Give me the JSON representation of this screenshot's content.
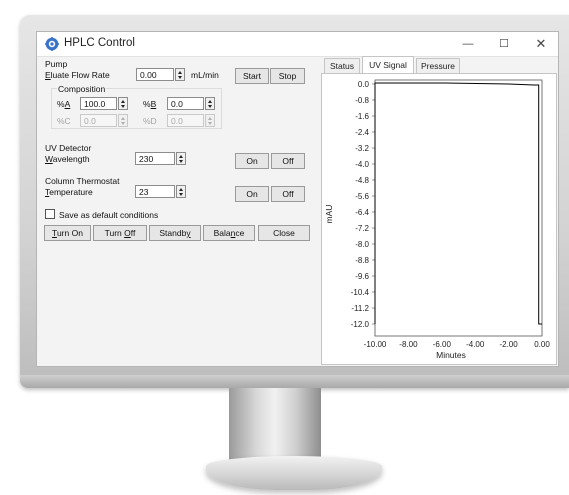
{
  "window": {
    "title": "HPLC Control",
    "minimize": "—",
    "maximize": "☐",
    "close": "✕"
  },
  "pump": {
    "heading": "Pump",
    "flow_label": "Eluate Flow Rate",
    "flow_accel": "E",
    "flow_rest": "luate Flow Rate",
    "flow_value": "0.00",
    "flow_unit": "mL/min",
    "start": "Start",
    "stop": "Stop",
    "composition": {
      "heading": "Composition",
      "a_prefix": "%",
      "a_letter": "A",
      "a_value": "100.0",
      "b_prefix": "%",
      "b_letter": "B",
      "b_value": "0.0",
      "c_label": "%C",
      "c_value": "0.0",
      "d_label": "%D",
      "d_value": "0.0"
    }
  },
  "uv": {
    "heading": "UV Detector",
    "wavelength_accel": "W",
    "wavelength_rest": "avelength",
    "wavelength_value": "230",
    "on": "On",
    "off": "Off"
  },
  "thermostat": {
    "heading": "Column Thermostat",
    "temp_accel": "T",
    "temp_rest": "emperature",
    "temp_value": "23",
    "on": "On",
    "off": "Off"
  },
  "save_default": {
    "label": "Save as default conditions",
    "checked": false
  },
  "actions": {
    "turn_on_a": "T",
    "turn_on_b": "urn On",
    "turn_off_a": "Turn ",
    "turn_off_b": "O",
    "turn_off_c": "ff",
    "standby_a": "Standb",
    "standby_b": "y",
    "balance_a": "Bala",
    "balance_b": "n",
    "balance_c": "ce",
    "close": "Close"
  },
  "tabs": [
    {
      "label": "Status",
      "active": false
    },
    {
      "label": "UV Signal",
      "active": true
    },
    {
      "label": "Pressure",
      "active": false
    }
  ],
  "chart_data": {
    "type": "line",
    "xlabel": "Minutes",
    "ylabel": "mAU",
    "xlim": [
      -10.0,
      0.0
    ],
    "ylim": [
      -12.6,
      0.2
    ],
    "x_ticks": [
      "-10.00",
      "-8.00",
      "-6.00",
      "-4.00",
      "-2.00",
      "0.00"
    ],
    "x_tick_values": [
      -10,
      -8,
      -6,
      -4,
      -2,
      0
    ],
    "y_ticks": [
      "0.0",
      "-0.8",
      "-1.6",
      "-2.4",
      "-3.2",
      "-4.0",
      "-4.8",
      "-5.6",
      "-6.4",
      "-7.2",
      "-8.0",
      "-8.8",
      "-9.6",
      "-10.4",
      "-11.2",
      "-12.0"
    ],
    "y_tick_values": [
      0,
      -0.8,
      -1.6,
      -2.4,
      -3.2,
      -4.0,
      -4.8,
      -5.6,
      -6.4,
      -7.2,
      -8.0,
      -8.8,
      -9.6,
      -10.4,
      -11.2,
      -12.0
    ],
    "grid": true,
    "series": [
      {
        "color": "#000000",
        "x": [
          -10.0,
          -10.0,
          -5.8,
          -2.0,
          -0.5,
          -0.2,
          -0.2,
          0.0
        ],
        "y": [
          -12.0,
          0.05,
          0.05,
          0.0,
          -0.05,
          -0.05,
          -12.0,
          -12.0
        ]
      }
    ]
  }
}
